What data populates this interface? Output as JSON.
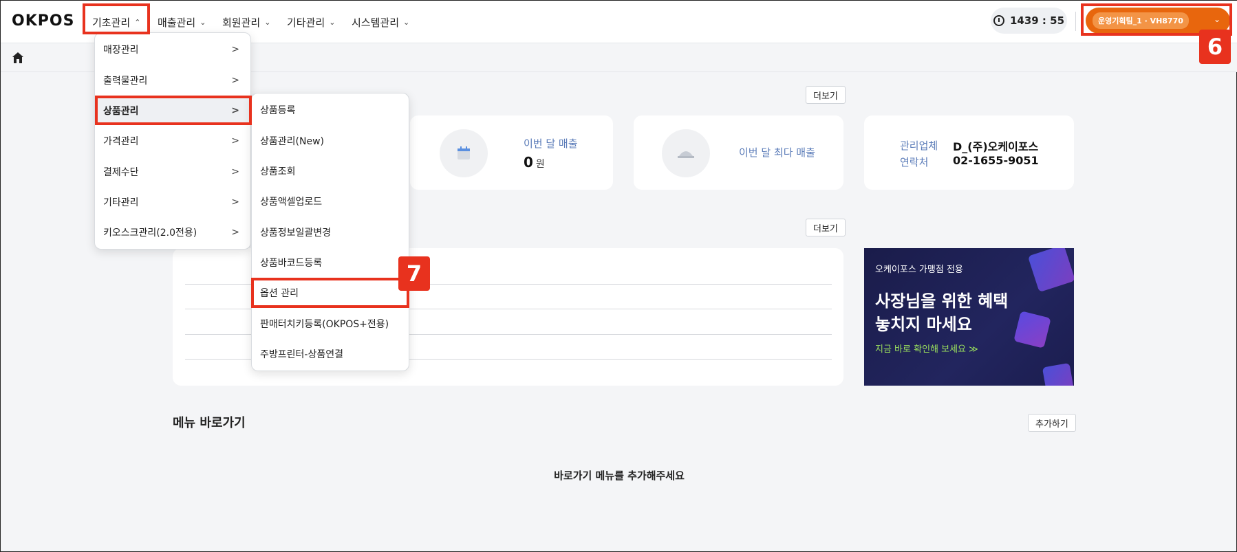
{
  "app": {
    "logo": "OKPOS"
  },
  "nav": {
    "items": [
      {
        "label": "기초관리",
        "chevron": "chevron-up-icon"
      },
      {
        "label": "매출관리",
        "chevron": "chevron-down-icon"
      },
      {
        "label": "회원관리",
        "chevron": "chevron-down-icon"
      },
      {
        "label": "기타관리",
        "chevron": "chevron-down-icon"
      },
      {
        "label": "시스템관리",
        "chevron": "chevron-down-icon"
      }
    ]
  },
  "session": {
    "timer": "1439 : 55",
    "user": "운영기획팀_1 · VH8770"
  },
  "colors": {
    "accent": "#e8660d",
    "highlight": "#e8321e",
    "label_blue": "#5a7bb8",
    "banner_bg": "#1a1c4a",
    "banner_cta": "#9be15d"
  },
  "cards": {
    "more_label": "더보기",
    "month_sales": {
      "label": "이번 달 매출",
      "value": "0",
      "unit": "원"
    },
    "month_max_sales": {
      "label": "이번 달 최다 매출"
    },
    "company": {
      "manager_key": "관리업체",
      "manager_value": "D_(주)오케이포스",
      "contact_key": "연락처",
      "contact_value": "02-1655-9051"
    }
  },
  "banner": {
    "small": "오케이포스 가맹점 전용",
    "line1": "사장님을 위한 혜택",
    "line2": "놓치지 마세요",
    "cta": "지금 바로 확인해 보세요 ≫"
  },
  "shortcuts": {
    "title": "메뉴 바로가기",
    "add_label": "추가하기",
    "empty": "바로가기 메뉴를 추가해주세요"
  },
  "menu_main": {
    "items": [
      {
        "label": "매장관리"
      },
      {
        "label": "출력물관리"
      },
      {
        "label": "상품관리"
      },
      {
        "label": "가격관리"
      },
      {
        "label": "결제수단"
      },
      {
        "label": "기타관리"
      },
      {
        "label": "키오스크관리(2.0전용)"
      }
    ],
    "arrow": ">"
  },
  "menu_sub": {
    "items": [
      {
        "label": "상품등록"
      },
      {
        "label": "상품관리(New)"
      },
      {
        "label": "상품조회"
      },
      {
        "label": "상품액셀업로드"
      },
      {
        "label": "상품정보일괄변경"
      },
      {
        "label": "상품바코드등록"
      },
      {
        "label": "옵션 관리"
      },
      {
        "label": "판매터치키등록(OKPOS+전용)"
      },
      {
        "label": "주방프린터-상품연결"
      }
    ]
  },
  "annotations": {
    "badge6": "6",
    "badge7": "7"
  }
}
